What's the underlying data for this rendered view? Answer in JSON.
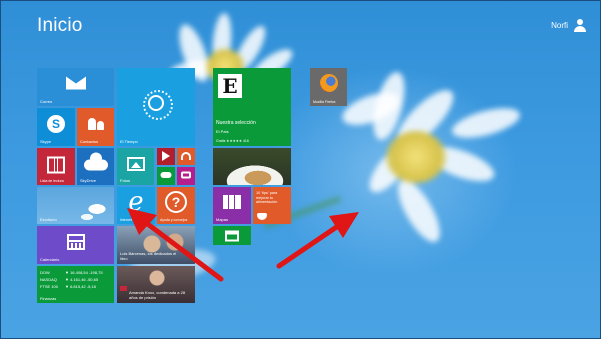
{
  "screen": {
    "title": "Inicio",
    "user_name": "Norfi"
  },
  "tiles": {
    "correo": {
      "label": "Correo",
      "icon": "mail-icon"
    },
    "tiempo": {
      "label": "El Tiempo",
      "icon": "sun-icon"
    },
    "skype": {
      "label": "Skype",
      "icon": "skype-icon"
    },
    "contactos": {
      "label": "Contactos",
      "icon": "people-icon"
    },
    "lista_lectura": {
      "label": "Lista de lectura",
      "icon": "book-icon"
    },
    "skydrive": {
      "label": "SkyDrive",
      "icon": "cloud-icon"
    },
    "fotos": {
      "label": "Fotos",
      "icon": "photo-icon"
    },
    "escritorio": {
      "label": "Escritorio"
    },
    "ie": {
      "label": "Internet Explorer",
      "icon": "ie-icon"
    },
    "ayuda": {
      "label": "Ayuda y consejos",
      "icon": "help-icon"
    },
    "calendario": {
      "label": "Calendario",
      "icon": "calendar-icon"
    },
    "noticia_1": {
      "headline": "Luis Bárcenas, los dedicados el libro"
    },
    "finanzas": {
      "label": "Finanzas",
      "lines": [
        "DOW",
        "NASDAQ",
        "FTSE 100"
      ],
      "values": [
        "▼ 16.408,54 -198,75",
        "▼ 4.161,46 -50,65",
        "▼ 6.815,42 -5,18"
      ]
    },
    "noticia_2": {
      "headline": "Amanda Knox, condenada a 28 años de prisión"
    },
    "noticias": {
      "letter": "E",
      "title": "Nuestra selección",
      "source": "El País",
      "rating": "Gratis ★★★★★ 416"
    },
    "firefox": {
      "label": "Mozilla Firefox",
      "icon": "firefox-icon"
    },
    "comida": {
      "label": ""
    },
    "mapas": {
      "label": "Mapas",
      "icon": "map-icon"
    },
    "salud": {
      "text": "10 'tips' para mejorar tu alimentación",
      "icon": "health-icon"
    },
    "tienda": {
      "icon": "store-icon"
    }
  },
  "colors": {
    "background": "#3d9ae0",
    "blue": "#2a8fd6",
    "sky": "#1aa0e0",
    "orange": "#e05a2a",
    "red": "#c4263a",
    "teal": "#1ba4a4",
    "magenta": "#b51e8c",
    "green": "#0a9a3a",
    "purple": "#6d4bc9",
    "arrow_red": "#e01515"
  }
}
